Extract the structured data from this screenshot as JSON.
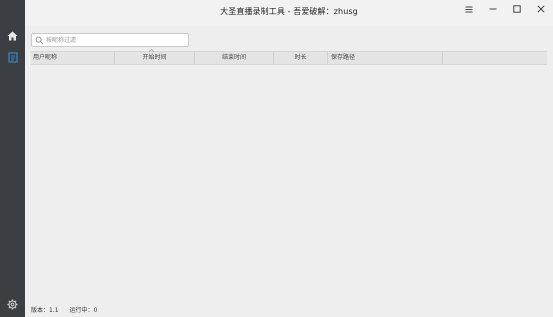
{
  "window": {
    "title": "大圣直播录制工具 - 吾爱破解：zhusg"
  },
  "sidebar": {
    "items": [
      {
        "icon": "home-icon"
      },
      {
        "icon": "list-icon"
      }
    ],
    "bottom_icon": "gear-icon"
  },
  "search": {
    "placeholder": "按昵称过滤",
    "value": ""
  },
  "table": {
    "columns": [
      "用户昵称",
      "开始时间",
      "结束时间",
      "时长",
      "保存路径",
      ""
    ],
    "rows": []
  },
  "status": {
    "version": "版本：1.1",
    "running": "运行中：0"
  },
  "colors": {
    "rail": "#3b3f43",
    "accent": "#3b86c6",
    "background": "#eeeeee"
  }
}
